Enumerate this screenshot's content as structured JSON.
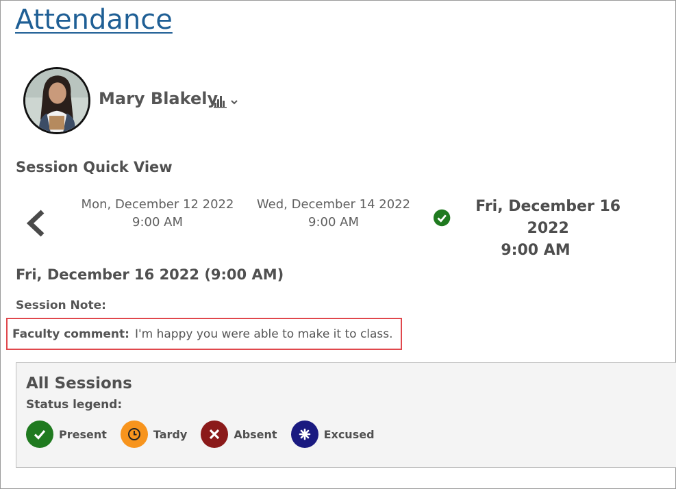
{
  "page": {
    "title": "Attendance"
  },
  "student": {
    "name": "Mary Blakely"
  },
  "quick_view": {
    "heading": "Session Quick View",
    "sessions": [
      {
        "date": "Mon, December 12 2022",
        "time": "9:00 AM"
      },
      {
        "date": "Wed, December 14 2022",
        "time": "9:00 AM"
      },
      {
        "date": "Fri, December 16 2022",
        "time": "9:00 AM",
        "status_icon": "check-icon"
      }
    ]
  },
  "selected_session": {
    "title": "Fri, December 16 2022 (9:00 AM)",
    "note_label": "Session Note:",
    "comment_label": "Faculty comment:",
    "comment_text": "I'm happy you were able to make it to class."
  },
  "all_sessions": {
    "title": "All Sessions",
    "legend_label": "Status legend:",
    "legend": [
      {
        "label": "Present",
        "icon": "check-icon",
        "color": "#1f7a1f"
      },
      {
        "label": "Tardy",
        "icon": "clock-icon",
        "color": "#f7941d"
      },
      {
        "label": "Absent",
        "icon": "x-icon",
        "color": "#8b1a1a"
      },
      {
        "label": "Excused",
        "icon": "asterisk-icon",
        "color": "#1a1a80"
      }
    ]
  },
  "colors": {
    "title_link": "#1f5f95",
    "highlight_border": "#e0474c",
    "present": "#1f7a1f"
  }
}
